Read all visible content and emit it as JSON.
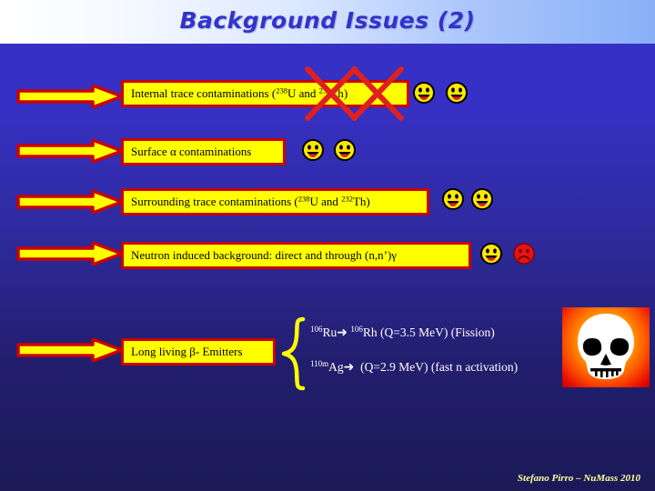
{
  "slide": {
    "title": "Background Issues (2)",
    "footer": "Stefano Pirro – NuMass 2010",
    "background_color": "#3730c4",
    "accent_box_fill": "#ffff00",
    "accent_box_border": "#cc0000",
    "arrow_fill": "#ffff00",
    "arrow_outline": "#cc0000",
    "x_mark_color": "#e02020",
    "brace_color": "#ffff00",
    "footer_color": "#ffff99",
    "title_color": "#3333cc"
  },
  "rows": [
    {
      "id": "internal-trace-contaminations",
      "arrow_icon": "right-arrow-icon",
      "label_prefix": "Internal trace contaminations (",
      "iso1_mass": "238",
      "iso1_sym": "U",
      "label_mid": " and ",
      "iso2_mass": "232",
      "iso2_sym": "Th",
      "label_suffix": ")",
      "struck_out": "true",
      "faces": [
        "happy",
        "happy"
      ]
    },
    {
      "id": "surface-alpha-contaminations",
      "arrow_icon": "right-arrow-icon",
      "label": "Surface α contaminations",
      "struck_out": "false",
      "faces": [
        "happy",
        "happy"
      ]
    },
    {
      "id": "surrounding-trace-contaminations",
      "arrow_icon": "right-arrow-icon",
      "label_prefix": "Surrounding trace contaminations (",
      "iso1_mass": "238",
      "iso1_sym": "U",
      "label_mid": " and ",
      "iso2_mass": "232",
      "iso2_sym": "Th",
      "label_suffix": ")",
      "struck_out": "false",
      "faces": [
        "happy",
        "happy"
      ]
    },
    {
      "id": "neutron-induced-background",
      "arrow_icon": "right-arrow-icon",
      "label": "Neutron induced background: direct and through (n,n’)γ",
      "struck_out": "false",
      "faces": [
        "happy",
        "sad"
      ]
    },
    {
      "id": "long-living-beta-emitters",
      "arrow_icon": "right-arrow-icon",
      "label": "Long living β- Emitters",
      "struck_out": "false",
      "faces": []
    }
  ],
  "beta_emitters": {
    "brace_icon": "curly-brace-icon",
    "lines": [
      {
        "parent_mass": "106",
        "parent_sym": "Ru",
        "arrow": "➜",
        "daughter_mass": "106",
        "daughter_sym": "Rh",
        "q_value": "(Q=3.5 MeV)",
        "mechanism": "(Fission)"
      },
      {
        "parent_mass": "110m",
        "parent_sym": "Ag",
        "arrow": "➜",
        "daughter_mass": "",
        "daughter_sym": "",
        "q_value": "(Q=2.9 MeV)",
        "mechanism": "(fast n activation)"
      }
    ]
  },
  "skull": {
    "icon": "skull-icon",
    "gradient_inner": "#ffe600",
    "gradient_outer": "#c00000"
  }
}
